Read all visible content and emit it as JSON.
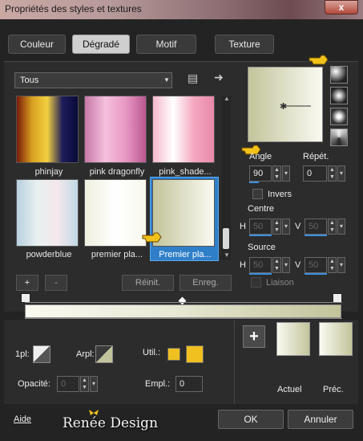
{
  "window": {
    "title": "Propriétés des styles et textures",
    "close_glyph": "x"
  },
  "tabs": [
    {
      "label": "Couleur",
      "active": false
    },
    {
      "label": "Dégradé",
      "active": true
    },
    {
      "label": "Motif",
      "active": false
    },
    {
      "label": "Texture",
      "active": false
    }
  ],
  "category": {
    "selected": "Tous"
  },
  "gradients": [
    {
      "name": "phinjay",
      "colors": [
        "#7a1a08",
        "#d8a020",
        "#f2d040",
        "#1c1c5a",
        "#0a0a3a"
      ]
    },
    {
      "name": "pink dragonfly",
      "colors": [
        "#c878a8",
        "#f4c0dc",
        "#e898c4",
        "#b85890"
      ]
    },
    {
      "name": "pink_shade...",
      "colors": [
        "#f6b8cc",
        "#ffffff",
        "#f4a8c0",
        "#e888a8"
      ]
    },
    {
      "name": "powderblue",
      "colors": [
        "#b8d0e0",
        "#e8f0f0",
        "#f4e8ec",
        "#c0d8e4"
      ]
    },
    {
      "name": "premier pla...",
      "colors": [
        "#f0f0e0",
        "#ffffff",
        "#f8f8ee"
      ]
    },
    {
      "name": "Premier pla...",
      "colors": [
        "#c2c49b",
        "#fafaf2"
      ],
      "selected": true
    }
  ],
  "settings": {
    "angle_label": "Angle",
    "angle": "90",
    "repeat_label": "Répét.",
    "repeat": "0",
    "invert_label": "Invers",
    "center_label": "Centre",
    "center_h_label": "H",
    "center_h": "50",
    "center_v_label": "V",
    "center_v": "50",
    "source_label": "Source",
    "source_h_label": "H",
    "source_h": "50",
    "source_v_label": "V",
    "source_v": "50",
    "link_label": "Liaison"
  },
  "list_buttons": {
    "add": "+",
    "remove": "-",
    "reset": "Réinit.",
    "save": "Enreg."
  },
  "stops": {
    "opacity_label": "Opacité:",
    "opacity": "0",
    "location_label": "Empl.:",
    "location": "0",
    "fg_label": "1pl:",
    "bg_label": "Arpl:",
    "user_label": "Util.:",
    "user_color": "#f0c020"
  },
  "swatches": {
    "add_label": "+",
    "current_label": "Actuel",
    "previous_label": "Préc."
  },
  "footer": {
    "help": "Aide",
    "logo": "Renée Design",
    "ok": "OK",
    "cancel": "Annuler"
  },
  "colors": {
    "accent": "#3b8fe0",
    "gradient_start": "#fafaf2",
    "gradient_end": "#c2c49b"
  }
}
